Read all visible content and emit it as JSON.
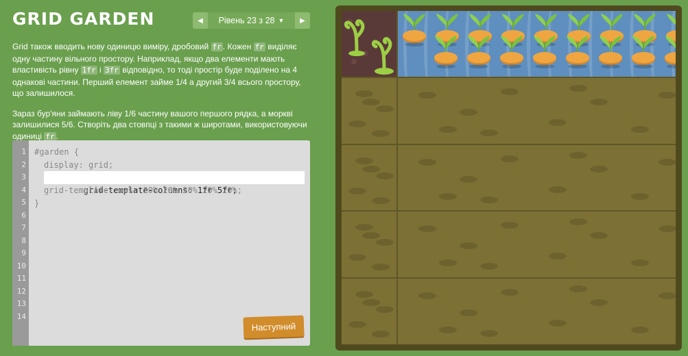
{
  "game": {
    "title": "GRID GARDEN",
    "level_label": "Рівень 23 з 28",
    "level_dropdown_glyph": "▼",
    "prev_glyph": "◀",
    "next_glyph": "▶"
  },
  "instructions": {
    "p1": [
      {
        "t": "Grid також вводить нову одиницю виміру, дробовий "
      },
      {
        "c": "fr"
      },
      {
        "t": ". Кожен "
      },
      {
        "c": "fr"
      },
      {
        "t": " виділяє одну частину вільного простору. Наприклад, якщо два елементи мають властивість рівну "
      },
      {
        "c": "1fr"
      },
      {
        "t": " і "
      },
      {
        "c": "3fr"
      },
      {
        "t": " відповідно, то тоді простір буде поділено на 4 однакові частини. Перший елемент займе 1/4 а другий 3/4 всього простору, що залишилося."
      }
    ],
    "p2": [
      {
        "t": "Зараз бур'яни займають ліву 1/6 частину вашого першого рядка, а моркві залишилися 5/6. Створіть два стовпці з такими ж широтами, використовуючи одиниці "
      },
      {
        "c": "fr"
      },
      {
        "t": "."
      }
    ]
  },
  "editor": {
    "line_numbers": [
      "1",
      "2",
      "3",
      "4",
      "5",
      "6",
      "7",
      "8",
      "9",
      "10",
      "11",
      "12",
      "13",
      "14"
    ],
    "line1": "#garden {",
    "line2": "display: grid;",
    "input_value": "grid-template-columns: 1fr 5fr;",
    "line4": "grid-template-rows: 20% 20% 20% 20% 20%;",
    "line5": "}",
    "next_button_label": "Наступний"
  },
  "colors": {
    "background": "#6a9f4e",
    "editor_bg": "#dcdcdc",
    "next_button": "#d18c2b",
    "soil": "#7d7035",
    "water": "#5e8fbf",
    "weed_bg": "#5a3a38",
    "carrot": "#e09a3a",
    "leaf": "#8fd14f"
  },
  "garden": {
    "rows": 5,
    "columns": "1fr 5fr",
    "weed_icon": "weed-icon",
    "carrot_icon": "carrot-icon"
  }
}
